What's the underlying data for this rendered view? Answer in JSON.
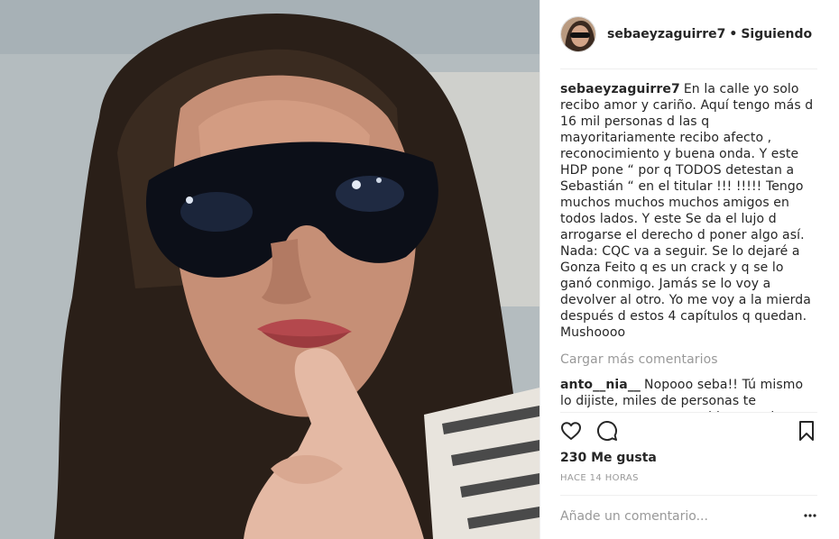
{
  "post": {
    "photo_icon": "person-photo",
    "author": "sebaeyzaguirre7",
    "separator": "•",
    "follow_status": "Siguiendo",
    "caption": {
      "username": "sebaeyzaguirre7",
      "text": "En la calle yo solo recibo amor y cariño. Aquí tengo más d 16 mil personas d las q mayoritariamente recibo afecto , reconocimiento y buena onda. Y este HDP pone “ por q TODOS detestan a Sebastián “ en el titular !!! !!!!! Tengo muchos muchos muchos amigos en todos lados. Y este Se da el lujo d arrogarse el derecho d poner algo así. Nada: CQC va a seguir. Se lo dejaré a Gonza Feito q es un crack y q se lo ganó conmigo. Jamás se lo voy a devolver al otro. Yo me voy a la mierda después d estos 4 capítulos q quedan. Mushoooo"
    },
    "load_more": "Cargar más comentarios",
    "comments": [
      {
        "username": "anto__nia__",
        "text": "Nopooo seba!! Tú mismo lo dijiste, miles de personas te apoyamos y estamos ahi, que solo eso quede!! A los demás pasatelos por la raja... No te bundas que los darás en el gusto"
      }
    ],
    "likes": "230 Me gusta",
    "timestamp": "HACE 14 HORAS",
    "add_comment_placeholder": "Añade un comentario...",
    "icons": {
      "like": "heart-icon",
      "comment": "comment-icon",
      "save": "bookmark-icon",
      "more": "more-options-icon"
    }
  }
}
